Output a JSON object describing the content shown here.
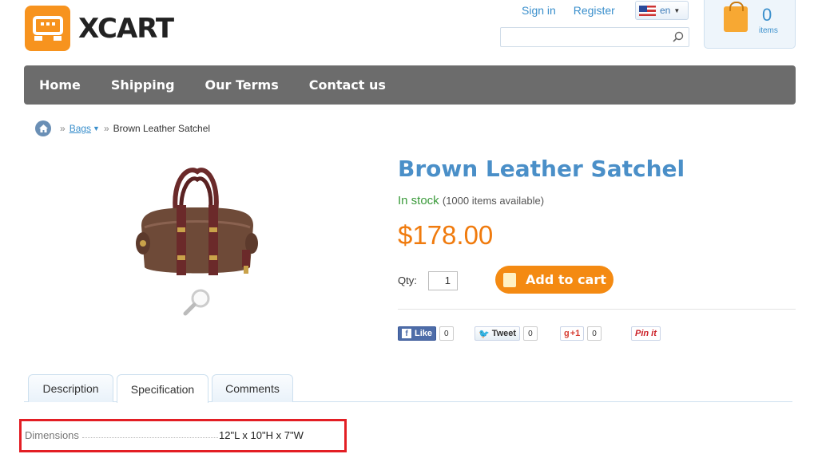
{
  "header": {
    "logo_text": "XCART",
    "sign_in": "Sign in",
    "register": "Register",
    "language": "en",
    "search_placeholder": "",
    "cart_count": "0",
    "cart_items_label": "items"
  },
  "nav": {
    "items": [
      {
        "label": "Home"
      },
      {
        "label": "Shipping"
      },
      {
        "label": "Our Terms"
      },
      {
        "label": "Contact us"
      }
    ]
  },
  "breadcrumb": {
    "separator": "»",
    "category": "Bags",
    "current": "Brown Leather Satchel"
  },
  "product": {
    "title": "Brown Leather Satchel",
    "stock_status": "In stock",
    "availability": "(1000 items available)",
    "price": "$178.00",
    "qty_label": "Qty:",
    "qty_value": "1",
    "add_to_cart": "Add to cart"
  },
  "social": {
    "like_label": "Like",
    "like_count": "0",
    "tweet_label": "Tweet",
    "tweet_count": "0",
    "gplus_label": "+1",
    "gplus_count": "0",
    "pin_label": "Pin it"
  },
  "tabs": [
    {
      "label": "Description"
    },
    {
      "label": "Specification"
    },
    {
      "label": "Comments"
    }
  ],
  "specification": {
    "label": "Dimensions",
    "value": "12\"L x 10\"H x 7\"W"
  },
  "colors": {
    "accent_blue": "#4a8fc8",
    "price_orange": "#f07b0e",
    "nav_gray": "#6c6c6c",
    "stock_green": "#3a9a3a",
    "highlight_red": "#e31e24"
  }
}
